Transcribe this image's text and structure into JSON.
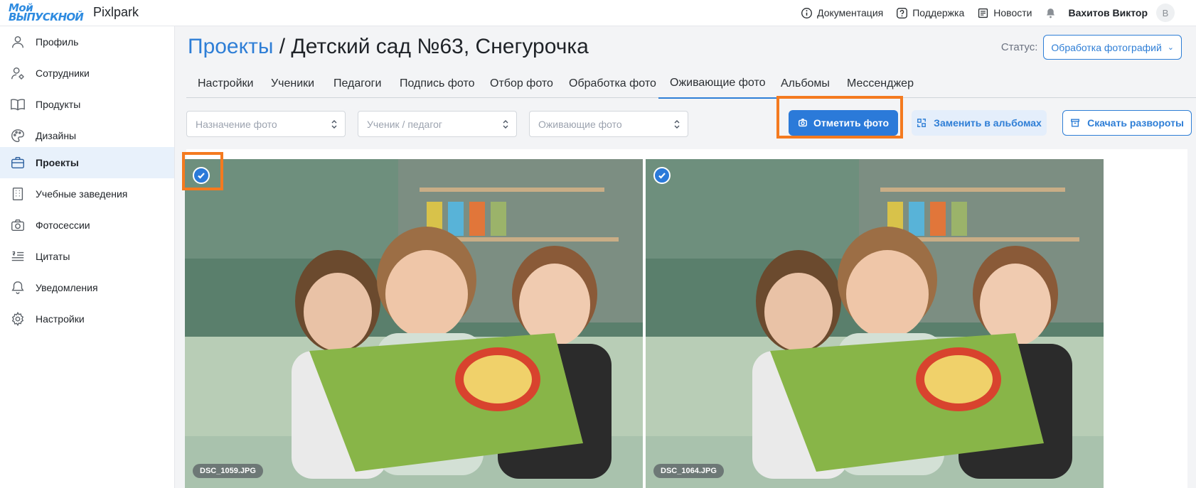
{
  "topbar": {
    "logo_line1": "Мой",
    "logo_line2": "ВЫПУСКНОЙ",
    "brand": "Pixlpark",
    "nav": [
      {
        "label": "Документация",
        "icon": "info-icon"
      },
      {
        "label": "Поддержка",
        "icon": "question-icon"
      },
      {
        "label": "Новости",
        "icon": "newspaper-icon"
      }
    ],
    "bell_icon": "bell-icon",
    "user_name": "Вахитов Виктор",
    "avatar_letter": "В"
  },
  "sidebar": {
    "items": [
      {
        "label": "Профиль",
        "icon": "user-icon"
      },
      {
        "label": "Сотрудники",
        "icon": "user-gear-icon"
      },
      {
        "label": "Продукты",
        "icon": "book-icon"
      },
      {
        "label": "Дизайны",
        "icon": "palette-icon"
      },
      {
        "label": "Проекты",
        "icon": "briefcase-icon",
        "active": true
      },
      {
        "label": "Учебные заведения",
        "icon": "building-icon"
      },
      {
        "label": "Фотосессии",
        "icon": "camera-icon"
      },
      {
        "label": "Цитаты",
        "icon": "quote-list-icon"
      },
      {
        "label": "Уведомления",
        "icon": "bell-icon"
      },
      {
        "label": "Настройки",
        "icon": "gear-icon"
      }
    ]
  },
  "header": {
    "breadcrumb_root": "Проекты",
    "separator": " / ",
    "project_title": "Детский сад №63, Снегурочка",
    "status_label": "Статус:",
    "status_value": "Обработка фотографий"
  },
  "tabs": [
    {
      "label": "Настройки"
    },
    {
      "label": "Ученики"
    },
    {
      "label": "Педагоги"
    },
    {
      "label": "Подпись фото"
    },
    {
      "label": "Отбор фото"
    },
    {
      "label": "Обработка фото"
    },
    {
      "label": "Оживающие фото",
      "active": true
    },
    {
      "label": "Альбомы"
    },
    {
      "label": "Мессенджер"
    }
  ],
  "filters": [
    {
      "placeholder": "Назначение фото"
    },
    {
      "placeholder": "Ученик / педагог"
    },
    {
      "placeholder": "Оживающие фото"
    }
  ],
  "actions": {
    "mark_photo": "Отметить фото",
    "replace_in_albums": "Заменить в альбомах",
    "download_spreads": "Скачать развороты"
  },
  "photos": [
    {
      "filename": "DSC_1059.JPG",
      "checked": true
    },
    {
      "filename": "DSC_1064.JPG",
      "checked": true
    }
  ],
  "colors": {
    "accent": "#2b7ad9",
    "highlight": "#f47a1f",
    "active_sidebar_bg": "#e8f1fb"
  }
}
